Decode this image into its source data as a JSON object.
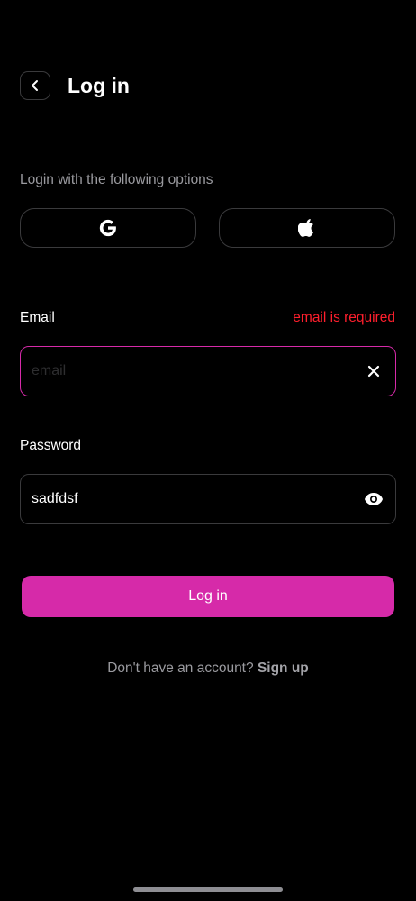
{
  "header": {
    "back_icon": "chevron-left-icon",
    "title": "Log in"
  },
  "social": {
    "label": "Login with the following options",
    "google_icon": "google-icon",
    "apple_icon": "apple-icon"
  },
  "email": {
    "label": "Email",
    "error": "email is required",
    "value": "",
    "placeholder": "email",
    "clear_icon": "close-icon"
  },
  "password": {
    "label": "Password",
    "value": "sadfdsf",
    "toggle_icon": "eye-icon"
  },
  "submit": {
    "label": "Log in"
  },
  "signup": {
    "prompt": "Don't have an account?",
    "link": "Sign up"
  },
  "colors": {
    "background": "#000000",
    "accent": "#d62aa9",
    "error": "#ff1f2d",
    "border": "#3a3a3c",
    "muted_text": "#9a9a9f"
  }
}
